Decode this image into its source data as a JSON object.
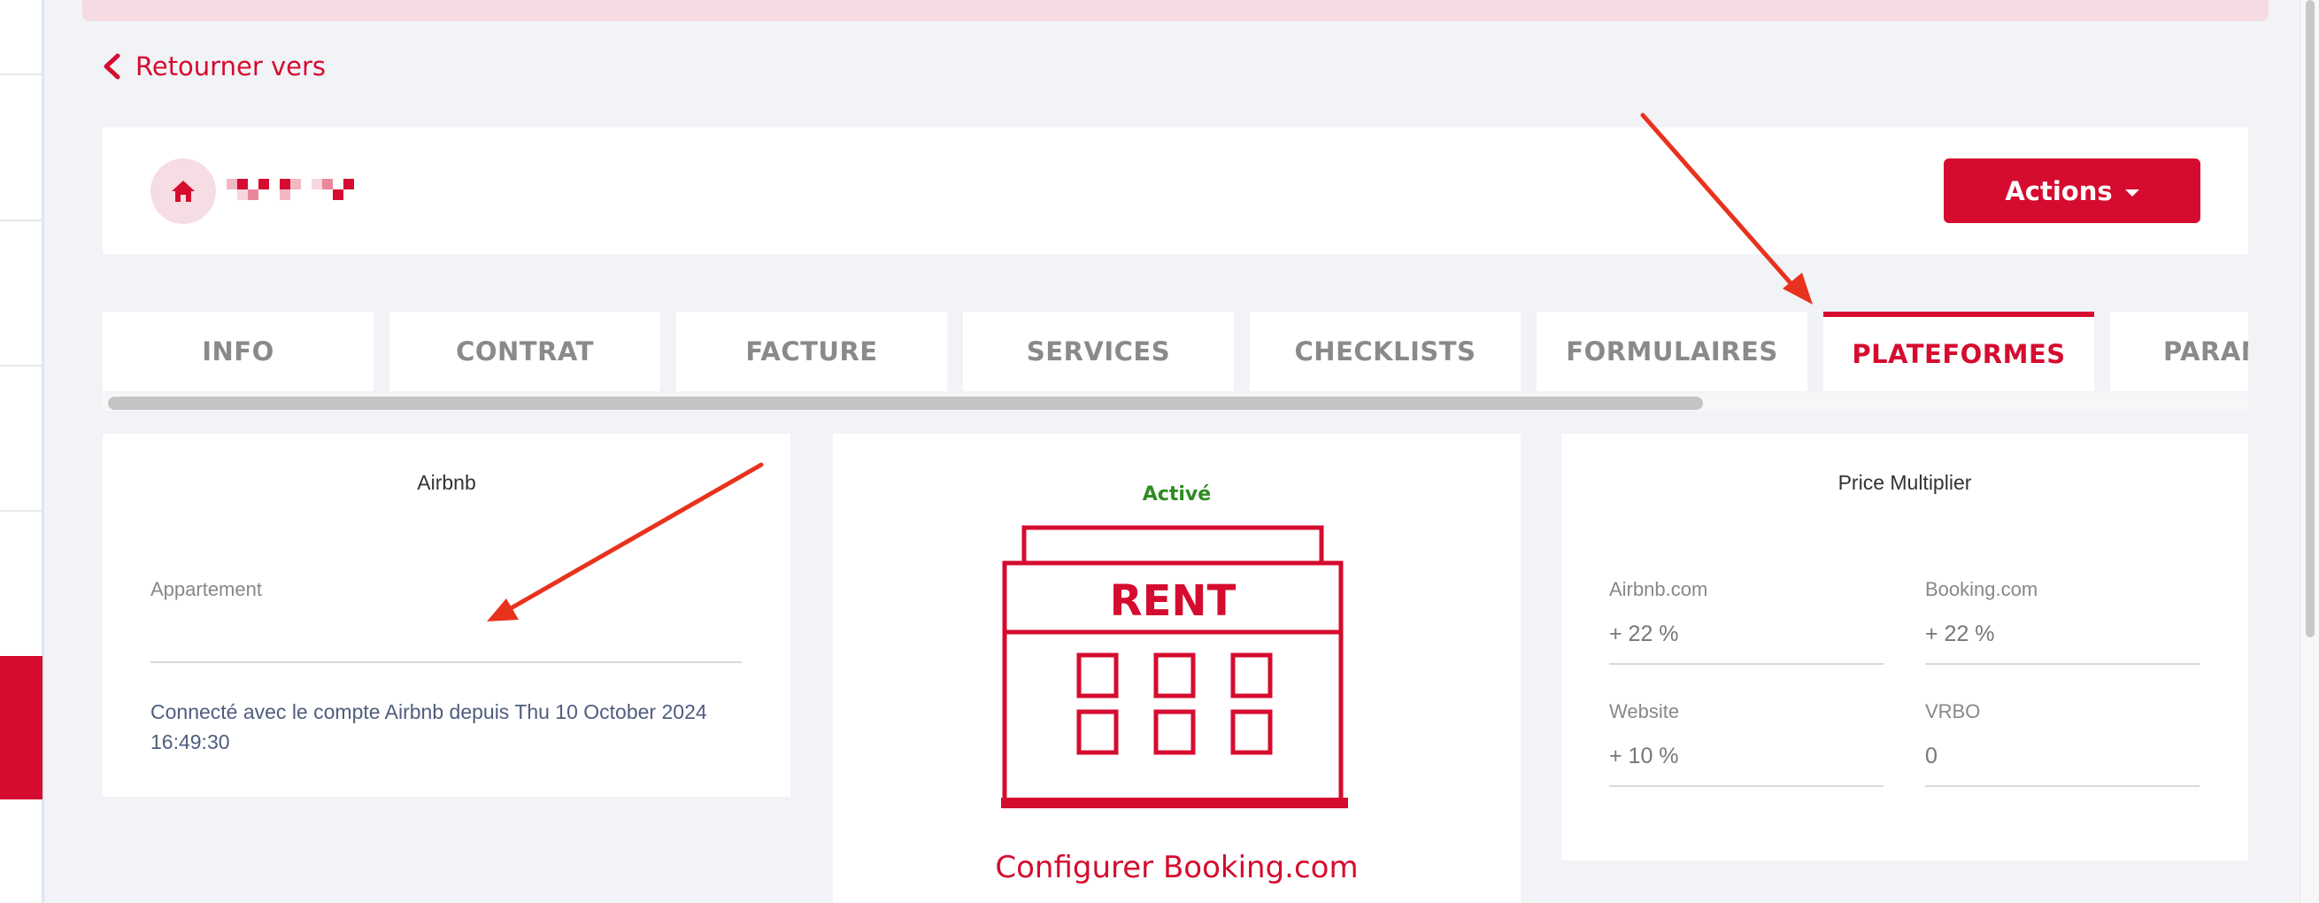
{
  "back": {
    "label": "Retourner vers"
  },
  "header": {
    "actions_label": "Actions"
  },
  "tabs": [
    {
      "label": "INFO"
    },
    {
      "label": "CONTRAT"
    },
    {
      "label": "FACTURE"
    },
    {
      "label": "SERVICES"
    },
    {
      "label": "CHECKLISTS"
    },
    {
      "label": "FORMULAIRES"
    },
    {
      "label": "PLATEFORMES"
    },
    {
      "label": "PARAM"
    }
  ],
  "active_tab": "PLATEFORMES",
  "airbnb": {
    "title": "Airbnb",
    "field_label": "Appartement",
    "field_value": "",
    "connected_text": "Connecté avec le compte Airbnb depuis Thu 10 October 2024 16:49:30"
  },
  "booking": {
    "status": "Activé",
    "sign_text": "RENT",
    "configure_label": "Configurer Booking.com"
  },
  "price_multiplier": {
    "title": "Price Multiplier",
    "airbnb_label": "Airbnb.com",
    "airbnb_value": "+ 22 %",
    "booking_label": "Booking.com",
    "booking_value": "+ 22 %",
    "website_label": "Website",
    "website_value": "+ 10 %",
    "vrbo_label": "VRBO",
    "vrbo_value": "0"
  },
  "colors": {
    "brand": "#d50c2f",
    "active_status": "#2e8b21",
    "annotation_arrow": "#e8321e"
  }
}
